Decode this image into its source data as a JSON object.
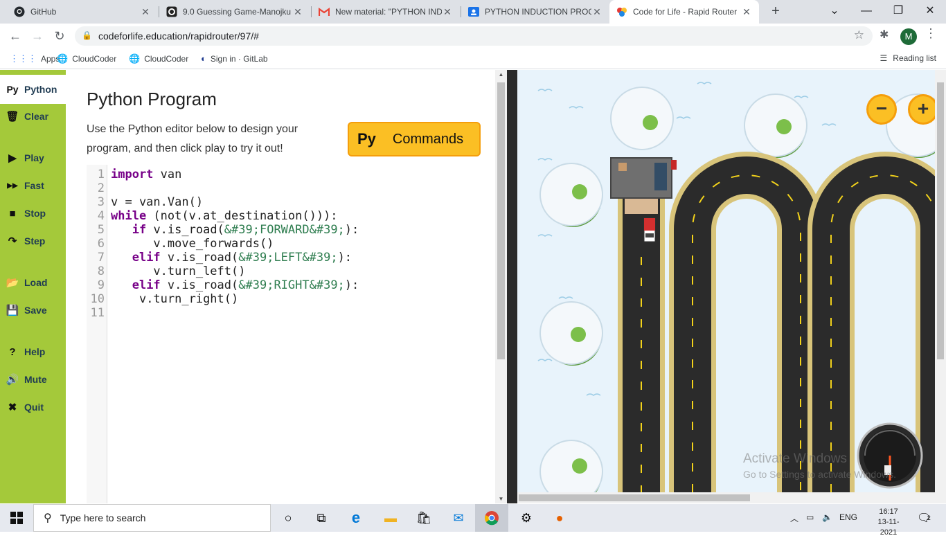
{
  "browser": {
    "tabs": [
      {
        "title": "GitHub",
        "active": false
      },
      {
        "title": "9.0 Guessing Game-Manojku",
        "active": false
      },
      {
        "title": "New material: \"PYTHON IND",
        "active": false
      },
      {
        "title": "PYTHON INDUCTION PROGR",
        "active": false
      },
      {
        "title": "Code for Life - Rapid Router",
        "active": true
      }
    ],
    "new_tab_label": "+",
    "url": "codeforlife.education/rapidrouter/97/#",
    "profile_initial": "M",
    "bookmarks": [
      "Apps",
      "CloudCoder",
      "CloudCoder",
      "Sign in · GitLab"
    ],
    "reading_list_label": "Reading list"
  },
  "sidebar": {
    "items": [
      {
        "icon": "Py",
        "label": "Python",
        "active": true
      },
      {
        "icon": "🗑",
        "label": "Clear"
      },
      {
        "icon": "▶",
        "label": "Play"
      },
      {
        "icon": "▶▶",
        "label": "Fast"
      },
      {
        "icon": "■",
        "label": "Stop"
      },
      {
        "icon": "↷",
        "label": "Step"
      },
      {
        "icon": "📂",
        "label": "Load"
      },
      {
        "icon": "💾",
        "label": "Save"
      },
      {
        "icon": "?",
        "label": "Help"
      },
      {
        "icon": "🔊",
        "label": "Mute"
      },
      {
        "icon": "✖",
        "label": "Quit"
      }
    ]
  },
  "panel": {
    "title": "Python Program",
    "description": "Use the Python editor below to design your program, and then click play to try it out!",
    "commands_button": {
      "icon_text": "Py",
      "label": "Commands"
    }
  },
  "editor": {
    "lines": [
      {
        "n": "1",
        "indent": "",
        "kw": "import",
        "rest": " van",
        "str": "",
        "tail": ""
      },
      {
        "n": "2",
        "indent": "",
        "kw": "",
        "rest": "",
        "str": "",
        "tail": ""
      },
      {
        "n": "3",
        "indent": "",
        "kw": "",
        "rest": "v = van.Van()",
        "str": "",
        "tail": ""
      },
      {
        "n": "4",
        "indent": "",
        "kw": "while",
        "rest": " (not(v.at_destination())):",
        "str": "",
        "tail": ""
      },
      {
        "n": "5",
        "indent": "   ",
        "kw": "if",
        "rest": " v.is_road(",
        "str": "&#39;FORWARD&#39;",
        "tail": "):"
      },
      {
        "n": "6",
        "indent": "      ",
        "kw": "",
        "rest": "v.move_forwards()",
        "str": "",
        "tail": ""
      },
      {
        "n": "7",
        "indent": "   ",
        "kw": "elif",
        "rest": " v.is_road(",
        "str": "&#39;LEFT&#39;",
        "tail": "):"
      },
      {
        "n": "8",
        "indent": "      ",
        "kw": "",
        "rest": "v.turn_left()",
        "str": "",
        "tail": ""
      },
      {
        "n": "9",
        "indent": "   ",
        "kw": "elif",
        "rest": " v.is_road(",
        "str": "&#39;RIGHT&#39;",
        "tail": "):"
      },
      {
        "n": "10",
        "indent": "    ",
        "kw": "",
        "rest": "v.turn_right()",
        "str": "",
        "tail": ""
      },
      {
        "n": "11",
        "indent": "",
        "kw": "",
        "rest": "",
        "str": "",
        "tail": ""
      }
    ]
  },
  "game": {
    "zoom_out_label": "−",
    "zoom_in_label": "+",
    "fuel_gauge_level": 0.15
  },
  "watermark": {
    "line1": "Activate Windows",
    "line2": "Go to Settings to activate Windows."
  },
  "taskbar": {
    "search_placeholder": "Type here to search",
    "language": "ENG",
    "time": "16:17",
    "date": "13-11-2021",
    "notification_count": "2"
  },
  "colors": {
    "sidebar_green": "#a4c93a",
    "commands_yellow": "#fbbf24",
    "keyword_purple": "#770088",
    "string_green": "#2e7d4f"
  }
}
